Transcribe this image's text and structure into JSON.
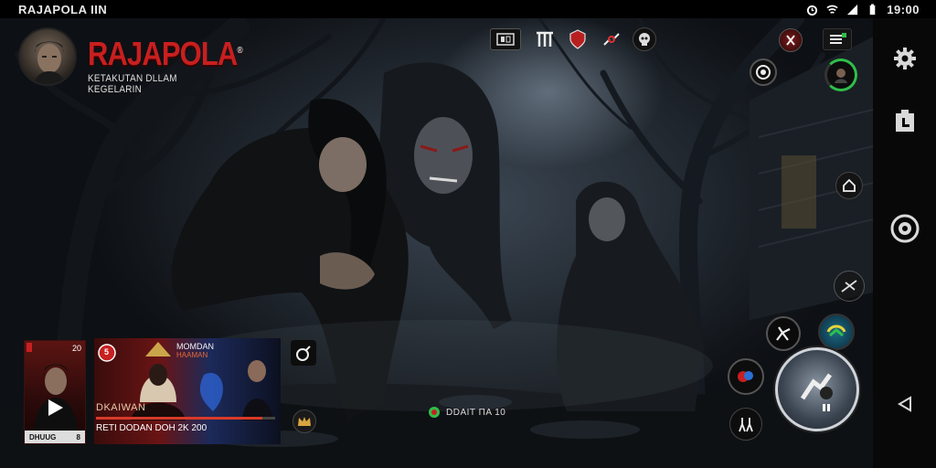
{
  "status_bar": {
    "app_name": "RAJAPOLA IIN",
    "time": "19:00",
    "icons": [
      "alarm-icon",
      "wifi-icon",
      "signal-icon",
      "battery-icon"
    ]
  },
  "game": {
    "title": "RAJAPOLA",
    "title_mark": "®",
    "subtitle": "KETAKUTAN DLLAM KEGELARIN"
  },
  "top_toolbar": {
    "icons": [
      "inventory-icon",
      "gate-icon",
      "shield-icon",
      "link-icon",
      "skull-icon"
    ]
  },
  "hud_right": {
    "icons": [
      "emblem-icon",
      "menu-icon",
      "compass-icon",
      "health-ring-icon",
      "house-icon",
      "blade-icon",
      "beast-icon",
      "globe-icon",
      "attack-icon",
      "dance-icon"
    ]
  },
  "rail": {
    "icons": [
      "gear-icon",
      "clipboard-icon",
      "target-icon",
      "back-triangle-icon"
    ]
  },
  "cards": {
    "left": {
      "level": "20",
      "caption": "DHUUG",
      "count": "8"
    },
    "main": {
      "top_line": "MOMDAN",
      "sub_line": "HAAMAN",
      "name": "DKAIWAN",
      "meta": "RETI DODAN DOH  2K 200",
      "badge": "5",
      "progress": 0.93
    },
    "side_icon": "bomb-icon",
    "bottom_icon": "crown-icon"
  },
  "readout": {
    "text": "DDAIT ΠΑ 10"
  },
  "colors": {
    "brand_red": "#c81f1f",
    "accent_green": "#2fbf4a",
    "rail_bg": "#080808"
  }
}
